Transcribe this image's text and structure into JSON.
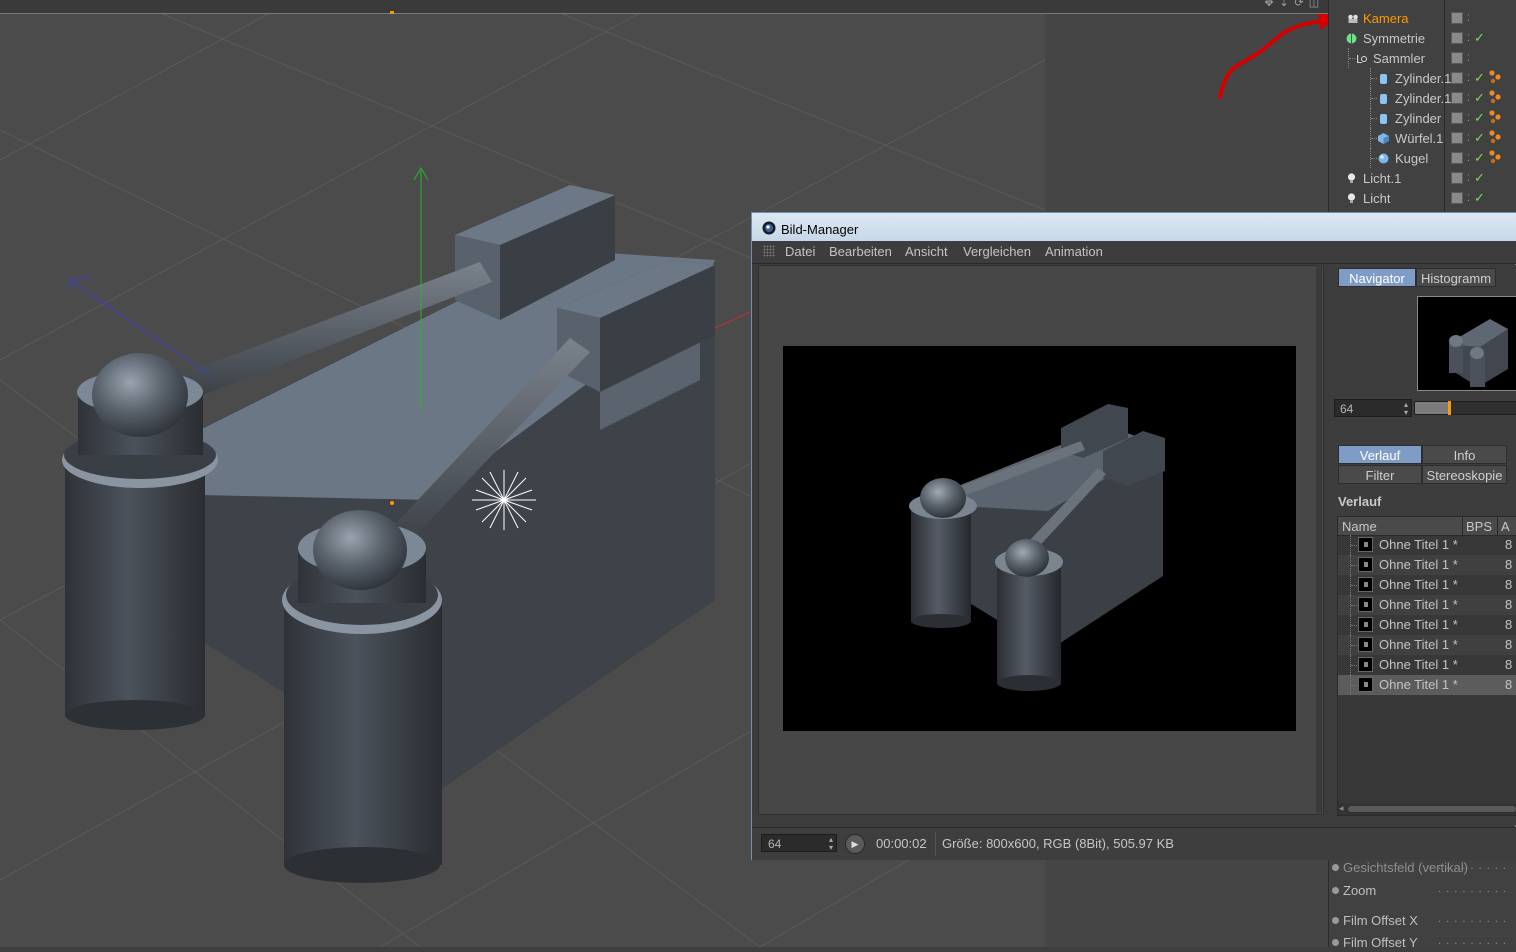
{
  "object_manager": {
    "items": [
      {
        "label": "Kamera",
        "active": true,
        "icon": "camera-icon",
        "indent": 0,
        "checked": false,
        "tag": false
      },
      {
        "label": "Symmetrie",
        "active": false,
        "icon": "symmetry-icon",
        "indent": 0,
        "checked": true,
        "tag": false
      },
      {
        "label": "Sammler",
        "active": false,
        "icon": "null-group-icon",
        "indent": 1,
        "checked": false,
        "tag": false
      },
      {
        "label": "Zylinder.1",
        "active": false,
        "icon": "cylinder-icon",
        "indent": 2,
        "checked": true,
        "tag": true
      },
      {
        "label": "Zylinder.1",
        "active": false,
        "icon": "cylinder-icon",
        "indent": 2,
        "checked": true,
        "tag": true
      },
      {
        "label": "Zylinder",
        "active": false,
        "icon": "cylinder-icon",
        "indent": 2,
        "checked": true,
        "tag": true
      },
      {
        "label": "Würfel.1",
        "active": false,
        "icon": "cube-icon",
        "indent": 2,
        "checked": true,
        "tag": true
      },
      {
        "label": "Kugel",
        "active": false,
        "icon": "sphere-icon",
        "indent": 2,
        "checked": true,
        "tag": true
      },
      {
        "label": "Licht.1",
        "active": false,
        "icon": "light-icon",
        "indent": 0,
        "checked": true,
        "tag": false
      },
      {
        "label": "Licht",
        "active": false,
        "icon": "light-icon",
        "indent": 0,
        "checked": true,
        "tag": false
      }
    ]
  },
  "attributes": {
    "rows": [
      {
        "label": "Gesichtsfeld (vertikal)",
        "dim": true
      },
      {
        "label": "Zoom",
        "dim": false
      },
      {
        "label": "Film Offset X",
        "dim": false
      },
      {
        "label": "Film Offset Y",
        "dim": false
      }
    ]
  },
  "bild_manager": {
    "title": "Bild-Manager",
    "menu": [
      "Datei",
      "Bearbeiten",
      "Ansicht",
      "Vergleichen",
      "Animation"
    ],
    "status": {
      "frame": "64",
      "time": "00:00:02",
      "info": "Größe: 800x600, RGB (8Bit), 505.97 KB"
    },
    "tabs_top": [
      "Navigator",
      "Histogramm"
    ],
    "zoom_value": "64",
    "zoom_fraction": 0.33,
    "tabs_lower": [
      "Verlauf",
      "Info",
      "Filter",
      "Stereoskopie"
    ],
    "section_title": "Verlauf",
    "history_columns": [
      "Name",
      "BPS",
      "A"
    ],
    "history": [
      {
        "name": "Ohne Titel 1 *",
        "num": "8"
      },
      {
        "name": "Ohne Titel 1 *",
        "num": "8"
      },
      {
        "name": "Ohne Titel 1 *",
        "num": "8"
      },
      {
        "name": "Ohne Titel 1 *",
        "num": "8"
      },
      {
        "name": "Ohne Titel 1 *",
        "num": "8"
      },
      {
        "name": "Ohne Titel 1 *",
        "num": "8"
      },
      {
        "name": "Ohne Titel 1 *",
        "num": "8"
      },
      {
        "name": "Ohne Titel 1 *",
        "num": "8"
      }
    ]
  },
  "colors": {
    "accent_orange": "#ff9a00",
    "tab_active": "#7e9cc6",
    "annotation_red": "#d40000"
  }
}
